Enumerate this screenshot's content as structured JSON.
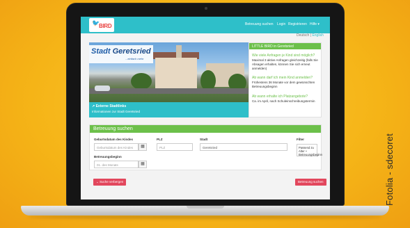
{
  "nav": {
    "logo_text": "BIRD",
    "links": [
      "Betreuung suchen",
      "Login",
      "Registrieren",
      "Hilfe ▾"
    ]
  },
  "lang": {
    "de": "Deutsch",
    "separator": "|",
    "en": "English"
  },
  "hero": {
    "city_name_part1": "Stadt ",
    "city_name_part2": "Geretsried",
    "city_tagline": "...einfach mehr",
    "caption_title": "Externe Stadtlinks",
    "caption_subtitle": "Informationen zur Stadt Geretsried"
  },
  "info": {
    "title": "LITTLE BIRD in Geretsried",
    "q1": "Wie viele Anfragen je Kind sind möglich?",
    "a1": "Maximal 3 aktive Anfragen gleichzeitig (falls Sie Absagen erhalten, können Sie sich erneut anmelden)",
    "q2": "Ab wann darf ich mein Kind anmelden?",
    "a2": "Frühestens 36 Monate vor dem gewünschten Betreuungsbeginn",
    "q3": "Ab wann erhalte ich Platzangebote?",
    "a3": "Ca. im April, nach Schuleinschreibungstermin"
  },
  "search": {
    "title": "Betreuung suchen",
    "birthdate_label": "Geburtsdatum des Kindes",
    "birthdate_placeholder": "Geburtsdatum des Kindes",
    "plz_label": "PLZ",
    "plz_placeholder": "PLZ",
    "city_label": "Stadt",
    "city_value": "Geretsried",
    "filter_label": "Filter",
    "filter_value": "Passend zu Alter + Betreuungsbeginn",
    "start_label": "Betreuungsbeginn",
    "start_placeholder": "01. des Monats",
    "hide_button": "Suche verbergen",
    "submit_button": "Betreuung suchen"
  },
  "credit": "Fotolia - sdecoret"
}
